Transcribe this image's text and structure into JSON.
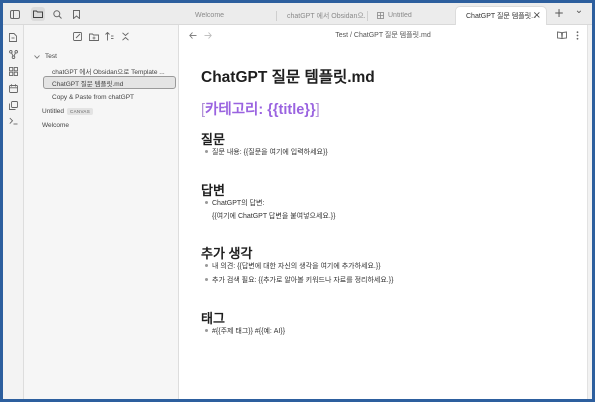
{
  "tabs": [
    {
      "label": "Welcome",
      "icon": "none",
      "active": false
    },
    {
      "label": "chatGPT 에서 Obsidan으...",
      "icon": "none",
      "active": false
    },
    {
      "label": "Untitled",
      "icon": "canvas-icon",
      "active": false
    },
    {
      "label": "ChatGPT 질문 템플릿...",
      "icon": "none",
      "active": true
    }
  ],
  "tab_close_glyph": "×",
  "tab_add_glyph": "+",
  "tab_dropdown_glyph": "⌄",
  "file_tree": {
    "folder": "Test",
    "items": [
      {
        "label": "chatGPT 에서 Obsidan으로 Template ...",
        "active": false
      },
      {
        "label": "ChatGPT 질문 템플릿.md",
        "active": true
      },
      {
        "label": "Copy & Paste from chatGPT",
        "active": false
      }
    ],
    "root_items": [
      {
        "label": "Untitled",
        "badge": "CANVAS"
      },
      {
        "label": "Welcome",
        "badge": ""
      }
    ]
  },
  "breadcrumb": "Test / ChatGPT 질문 템플릿.md",
  "document": {
    "title": "ChatGPT 질문 템플릿.md",
    "category_open": "[",
    "category_text": "카테고리: {{title}}",
    "category_close": "]",
    "sections": [
      {
        "heading": "질문",
        "lines": [
          {
            "type": "bullet",
            "text": "질문 내용: {{질문을 여기에 입력하세요}}"
          }
        ]
      },
      {
        "heading": "답변",
        "lines": [
          {
            "type": "bullet",
            "text": "ChatGPT의 답변:"
          },
          {
            "type": "cont",
            "text": "{{여기에 ChatGPT 답변을 붙여넣으세요.}}"
          }
        ]
      },
      {
        "heading": "추가 생각",
        "lines": [
          {
            "type": "bullet",
            "text": "내 의견: {{답변에 대한 자신의 생각을 여기에 추가하세요.}}"
          },
          {
            "type": "bullet",
            "text": "추가 검색 필요: {{추가로 알아볼 키워드나 자료를 정리하세요.}}"
          }
        ]
      },
      {
        "heading": "태그",
        "lines": [
          {
            "type": "bullet",
            "text": "#{{주제 태그}} #{{예: AI}}"
          }
        ]
      }
    ]
  },
  "colors": {
    "frame_border": "#2d5f9e",
    "category_accent": "#9a63e0"
  }
}
